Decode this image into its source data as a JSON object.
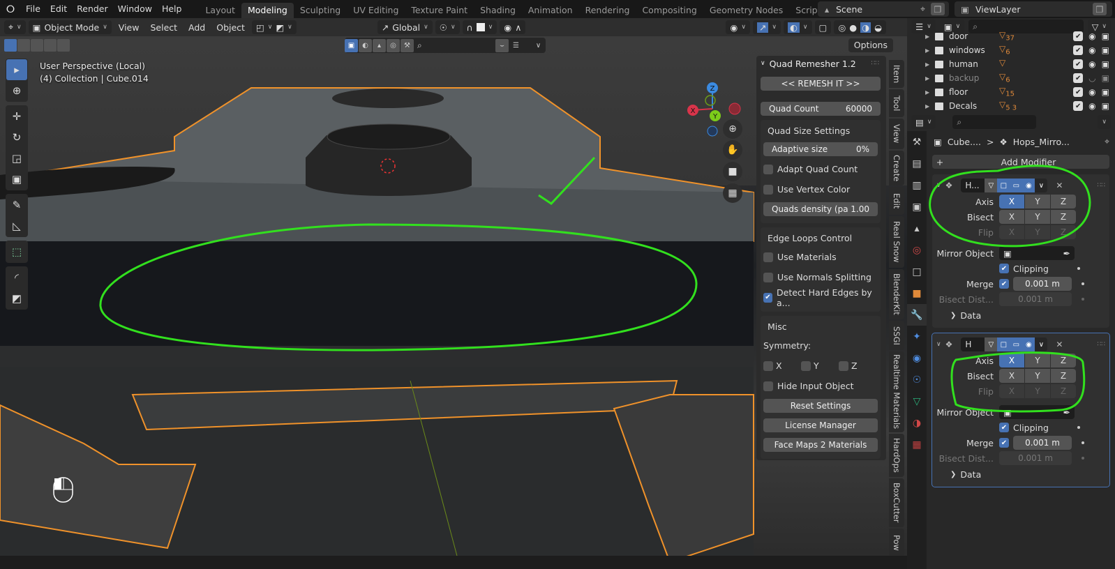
{
  "topbar": {
    "menus": [
      "File",
      "Edit",
      "Render",
      "Window",
      "Help"
    ],
    "workspaces": [
      "Layout",
      "Modeling",
      "Sculpting",
      "UV Editing",
      "Texture Paint",
      "Shading",
      "Animation",
      "Rendering",
      "Compositing",
      "Geometry Nodes",
      "Scripting"
    ],
    "active_workspace": "Modeling",
    "add_workspace": "+",
    "scene": "Scene",
    "view_layer": "ViewLayer"
  },
  "viewport_header": {
    "mode": "Object Mode",
    "menus": [
      "View",
      "Select",
      "Add",
      "Object"
    ],
    "orientation": "Global",
    "options_label": "Options"
  },
  "viewport": {
    "perspective": "User Perspective (Local)",
    "collection": "(4) Collection | Cube.014",
    "gizmo_axes": [
      "X",
      "Y",
      "Z"
    ],
    "accent_selection": "#f0922a",
    "annotation_color": "#32e01e"
  },
  "npanel": {
    "title": "Quad Remesher 1.2",
    "remesh_button": "<<  REMESH IT >>",
    "quad_count_label": "Quad Count",
    "quad_count_value": "60000",
    "quad_size": {
      "title": "Quad Size Settings",
      "adaptive_label": "Adaptive size",
      "adaptive_value": "0%",
      "adapt_quad_count": "Adapt Quad Count",
      "use_vertex_color": "Use Vertex Color",
      "density_label": "Quads density (pa",
      "density_value": "1.00"
    },
    "edge_loops": {
      "title": "Edge Loops Control",
      "use_materials": "Use Materials",
      "use_normals": "Use Normals Splitting",
      "detect_hard": "Detect Hard Edges by a..."
    },
    "misc": {
      "title": "Misc",
      "symmetry_label": "Symmetry:",
      "sym_x": "X",
      "sym_y": "Y",
      "sym_z": "Z",
      "hide_input": "Hide Input Object",
      "reset": "Reset Settings",
      "license": "License Manager",
      "facemaps": "Face Maps 2 Materials"
    },
    "tabs": [
      "Item",
      "Tool",
      "View",
      "Create",
      "Edit",
      "Real Snow",
      "BlenderKit",
      "SSGI",
      "Realtime Materials",
      "HardOps",
      "BoxCutter",
      "Pow"
    ]
  },
  "outliner": {
    "rows": [
      {
        "name": "door",
        "count": "37",
        "dim": false
      },
      {
        "name": "windows",
        "count": "6",
        "dim": false
      },
      {
        "name": "human",
        "count": "",
        "dim": false
      },
      {
        "name": "backup",
        "count": "6",
        "dim": true
      },
      {
        "name": "floor",
        "count": "15",
        "dim": false
      },
      {
        "name": "Decals",
        "count": "5 3",
        "dim": false
      }
    ]
  },
  "properties": {
    "breadcrumb_object": "Cube....",
    "breadcrumb_sep": ">",
    "breadcrumb_modifier": "Hops_Mirro...",
    "add_modifier": "Add Modifier",
    "modifiers": [
      {
        "name": "H...",
        "axis_label": "Axis",
        "bisect_label": "Bisect",
        "flip_label": "Flip",
        "mirror_object_label": "Mirror Object",
        "clipping_label": "Clipping",
        "merge_label": "Merge",
        "merge_value": "0.001 m",
        "bisect_dist_label": "Bisect Dist...",
        "bisect_dist_value": "0.001 m",
        "data_label": "Data"
      },
      {
        "name": "H",
        "axis_label": "Axis",
        "bisect_label": "Bisect",
        "flip_label": "Flip",
        "mirror_object_label": "Mirror Object",
        "clipping_label": "Clipping",
        "merge_label": "Merge",
        "merge_value": "0.001 m",
        "bisect_dist_label": "Bisect Dist...",
        "bisect_dist_value": "0.001 m",
        "data_label": "Data"
      }
    ],
    "xyz": [
      "X",
      "Y",
      "Z"
    ]
  }
}
